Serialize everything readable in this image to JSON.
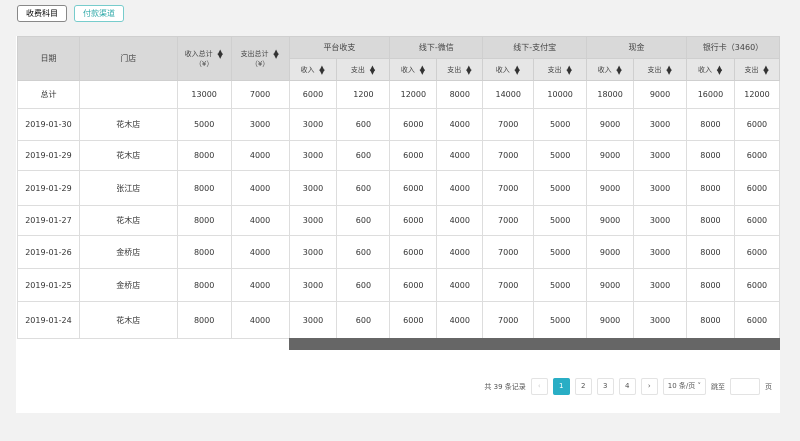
{
  "tabs": [
    "收费科目",
    "付款渠道"
  ],
  "headers": {
    "date": "日期",
    "store": "门店",
    "income_total": "收入总计",
    "expense_total": "支出总计",
    "currency": "（¥）",
    "income": "收入",
    "expense": "支出",
    "groups": [
      "平台收支",
      "线下-微信",
      "线下-支付宝",
      "现金",
      "银行卡（3460）"
    ]
  },
  "total": {
    "label": "总计",
    "values": [
      "13000",
      "7000",
      "6000",
      "1200",
      "12000",
      "8000",
      "14000",
      "10000",
      "18000",
      "9000",
      "16000",
      "12000"
    ]
  },
  "rows": [
    {
      "date": "2019-01-30",
      "store": "花木店",
      "values": [
        "5000",
        "3000",
        "3000",
        "600",
        "6000",
        "4000",
        "7000",
        "5000",
        "9000",
        "3000",
        "8000",
        "6000"
      ]
    },
    {
      "date": "2019-01-29",
      "store": "花木店",
      "values": [
        "8000",
        "4000",
        "3000",
        "600",
        "6000",
        "4000",
        "7000",
        "5000",
        "9000",
        "3000",
        "8000",
        "6000"
      ]
    },
    {
      "date": "2019-01-29",
      "store": "张江店",
      "values": [
        "8000",
        "4000",
        "3000",
        "600",
        "6000",
        "4000",
        "7000",
        "5000",
        "9000",
        "3000",
        "8000",
        "6000"
      ]
    },
    {
      "date": "2019-01-27",
      "store": "花木店",
      "values": [
        "8000",
        "4000",
        "3000",
        "600",
        "6000",
        "4000",
        "7000",
        "5000",
        "9000",
        "3000",
        "8000",
        "6000"
      ]
    },
    {
      "date": "2019-01-26",
      "store": "金桥店",
      "values": [
        "8000",
        "4000",
        "3000",
        "600",
        "6000",
        "4000",
        "7000",
        "5000",
        "9000",
        "3000",
        "8000",
        "6000"
      ]
    },
    {
      "date": "2019-01-25",
      "store": "金桥店",
      "values": [
        "8000",
        "4000",
        "3000",
        "600",
        "6000",
        "4000",
        "7000",
        "5000",
        "9000",
        "3000",
        "8000",
        "6000"
      ]
    },
    {
      "date": "2019-01-24",
      "store": "花木店",
      "values": [
        "8000",
        "4000",
        "3000",
        "600",
        "6000",
        "4000",
        "7000",
        "5000",
        "9000",
        "3000",
        "8000",
        "6000"
      ]
    }
  ],
  "pagination": {
    "total": "共 39 条记录",
    "prev": "‹",
    "pages": [
      "1",
      "2",
      "3",
      "4"
    ],
    "next": "›",
    "page_size": "10 条/页",
    "jump_label": "跳至",
    "page_unit": "页"
  }
}
